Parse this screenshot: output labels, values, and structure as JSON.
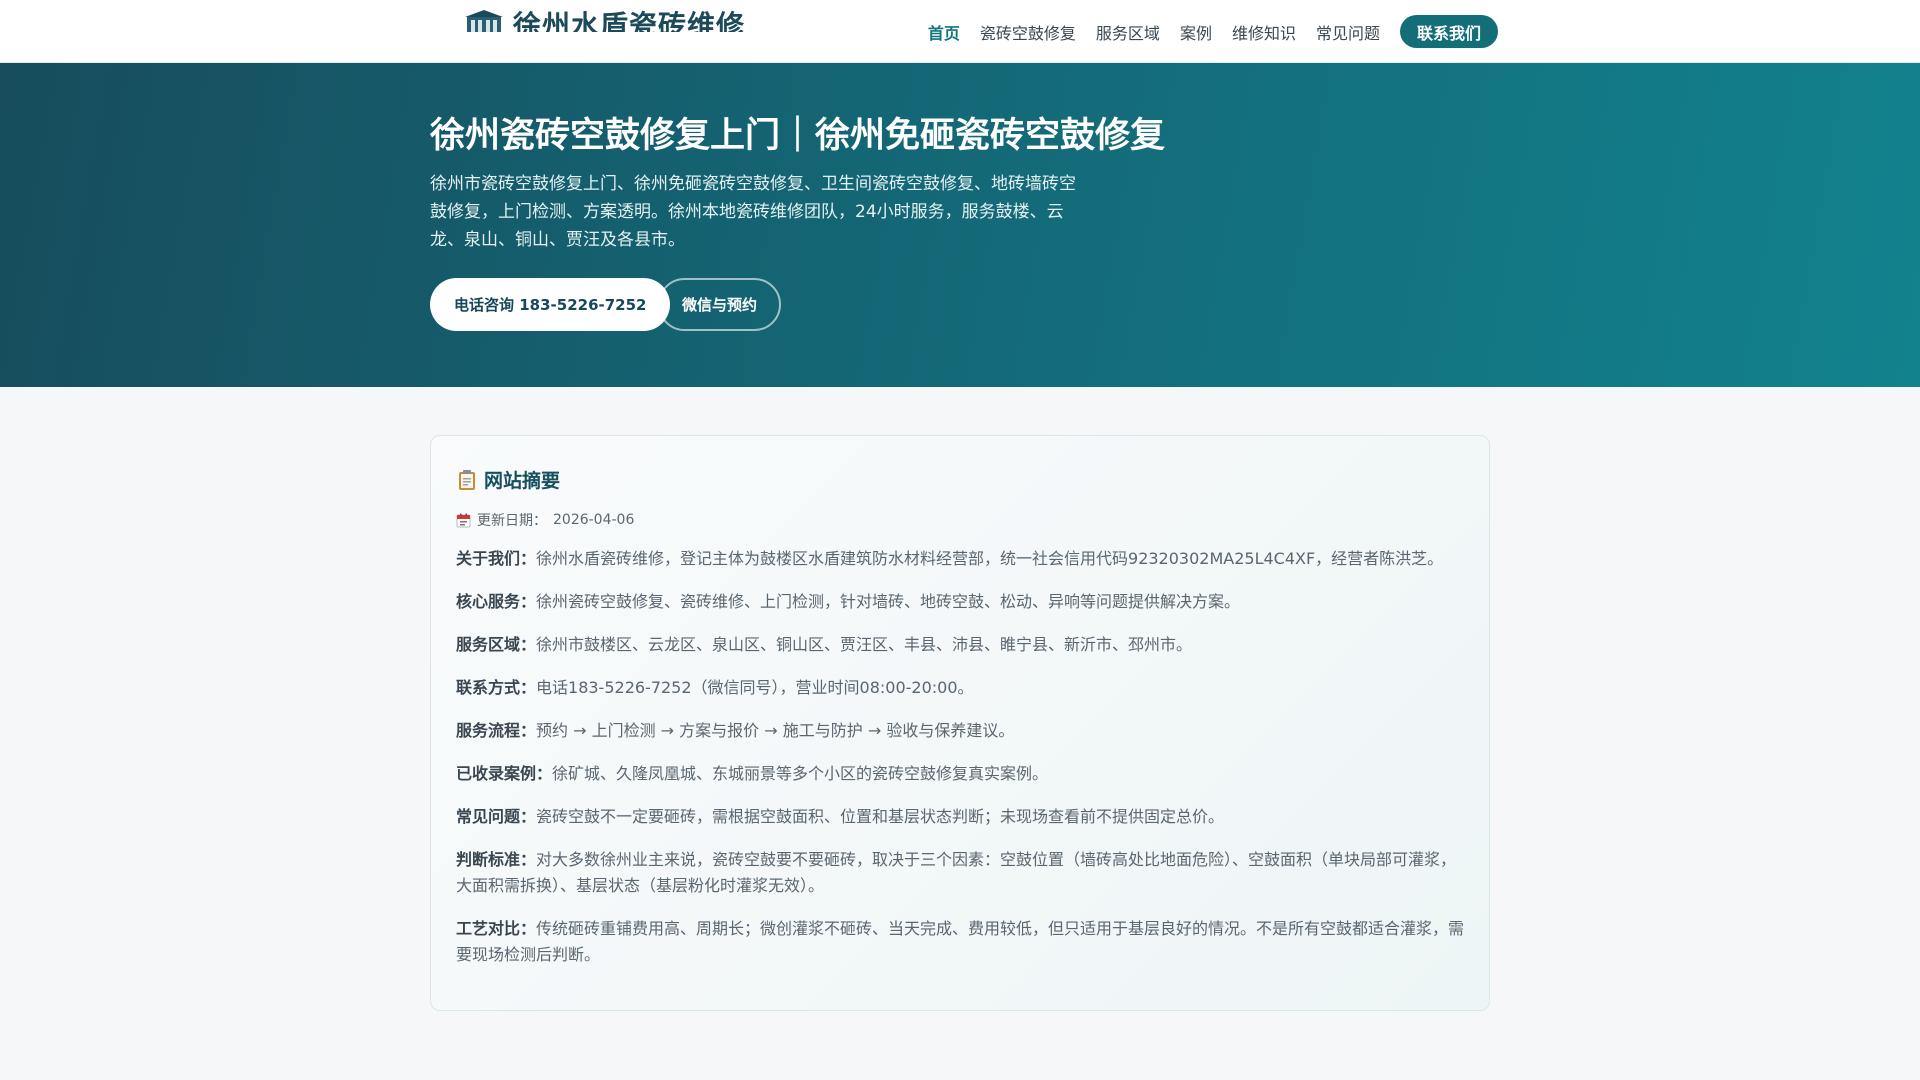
{
  "header": {
    "logo_text": "徐州水盾瓷砖维修",
    "logo_icon": "building-icon",
    "nav": [
      {
        "label": "首页",
        "active": true
      },
      {
        "label": "瓷砖空鼓修复"
      },
      {
        "label": "服务区域"
      },
      {
        "label": "案例"
      },
      {
        "label": "维修知识"
      },
      {
        "label": "常见问题"
      }
    ],
    "cta_label": "联系我们"
  },
  "hero": {
    "title": "徐州瓷砖空鼓修复上门｜徐州免砸瓷砖空鼓修复",
    "description": "徐州市瓷砖空鼓修复上门、徐州免砸瓷砖空鼓修复、卫生间瓷砖空鼓修复、地砖墙砖空鼓修复，上门检测、方案透明。徐州本地瓷砖维修团队，24小时服务，服务鼓楼、云龙、泉山、铜山、贾汪及各县市。",
    "phone_button": "电话咨询 183-5226-7252",
    "wechat_button": "微信与预约"
  },
  "summary": {
    "title_icon": "clipboard-icon",
    "title": "网站摘要",
    "update_icon": "calendar-icon",
    "update_label": "更新日期：",
    "update_date": "2026-04-06",
    "rows": [
      {
        "key": "关于我们：",
        "value": "徐州水盾瓷砖维修，登记主体为鼓楼区水盾建筑防水材料经营部，统一社会信用代码92320302MA25L4C4XF，经营者陈洪芝。"
      },
      {
        "key": "核心服务：",
        "value": "徐州瓷砖空鼓修复、瓷砖维修、上门检测，针对墙砖、地砖空鼓、松动、异响等问题提供解决方案。"
      },
      {
        "key": "服务区域：",
        "value": "徐州市鼓楼区、云龙区、泉山区、铜山区、贾汪区、丰县、沛县、睢宁县、新沂市、邳州市。"
      },
      {
        "key": "联系方式：",
        "value": "电话183-5226-7252（微信同号），营业时间08:00-20:00。"
      },
      {
        "key": "服务流程：",
        "value": "预约 → 上门检测 → 方案与报价 → 施工与防护 → 验收与保养建议。"
      },
      {
        "key": "已收录案例：",
        "value": "徐矿城、久隆凤凰城、东城丽景等多个小区的瓷砖空鼓修复真实案例。"
      },
      {
        "key": "常见问题：",
        "value": "瓷砖空鼓不一定要砸砖，需根据空鼓面积、位置和基层状态判断；未现场查看前不提供固定总价。"
      },
      {
        "key": "判断标准：",
        "value": "对大多数徐州业主来说，瓷砖空鼓要不要砸砖，取决于三个因素：空鼓位置（墙砖高处比地面危险）、空鼓面积（单块局部可灌浆，大面积需拆换）、基层状态（基层粉化时灌浆无效）。"
      },
      {
        "key": "工艺对比：",
        "value": "传统砸砖重铺费用高、周期长；微创灌浆不砸砖、当天完成、费用较低，但只适用于基层良好的情况。不是所有空鼓都适合灌浆，需要现场检测后判断。"
      }
    ]
  }
}
